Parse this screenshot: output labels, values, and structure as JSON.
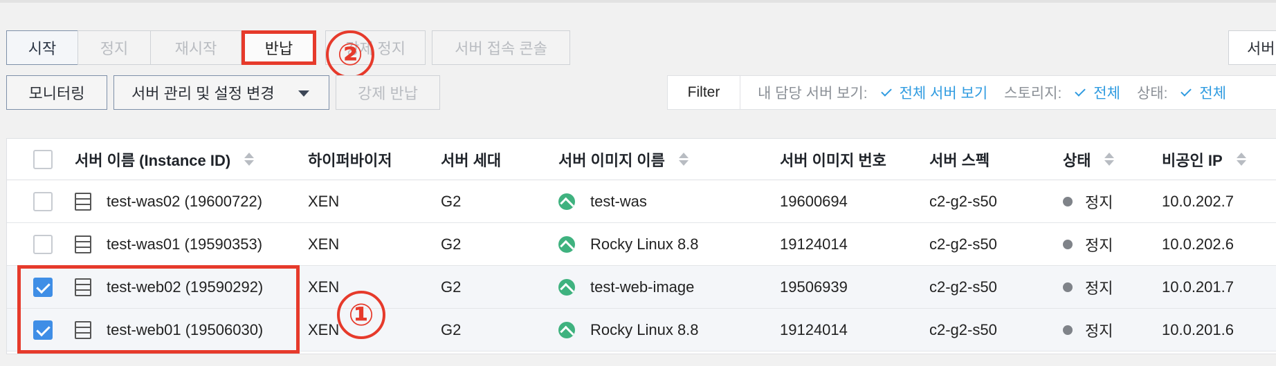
{
  "toolbar": {
    "row1": {
      "start": "시작",
      "stop": "정지",
      "restart": "재시작",
      "return": "반납",
      "force_stop": "강제 정지",
      "console": "서버 접속 콘솔",
      "right_cut": "서버"
    },
    "row2": {
      "monitoring": "모니터링",
      "manage": "서버 관리 및 설정 변경",
      "force_return": "강제 반납"
    }
  },
  "markers": {
    "one": "①",
    "two": "②"
  },
  "filter": {
    "label": "Filter",
    "my_servers_key": "내 담당 서버 보기:",
    "my_servers_value": "전체 서버 보기",
    "storage_key": "스토리지:",
    "storage_value": "전체",
    "status_key": "상태:",
    "status_value": "전체"
  },
  "table": {
    "headers": {
      "name": "서버 이름 (Instance ID)",
      "hypervisor": "하이퍼바이저",
      "generation": "서버 세대",
      "image_name": "서버 이미지 이름",
      "image_no": "서버 이미지 번호",
      "spec": "서버 스펙",
      "status": "상태",
      "private_ip": "비공인 IP"
    },
    "rows": [
      {
        "name": "test-was02 (19600722)",
        "hypervisor": "XEN",
        "generation": "G2",
        "image_name": "test-was",
        "image_no": "19600694",
        "spec": "c2-g2-s50",
        "status": "정지",
        "private_ip": "10.0.202.7",
        "checked": false
      },
      {
        "name": "test-was01 (19590353)",
        "hypervisor": "XEN",
        "generation": "G2",
        "image_name": "Rocky Linux 8.8",
        "image_no": "19124014",
        "spec": "c2-g2-s50",
        "status": "정지",
        "private_ip": "10.0.202.6",
        "checked": false
      },
      {
        "name": "test-web02 (19590292)",
        "hypervisor": "XEN",
        "generation": "G2",
        "image_name": "test-web-image",
        "image_no": "19506939",
        "spec": "c2-g2-s50",
        "status": "정지",
        "private_ip": "10.0.201.7",
        "checked": true
      },
      {
        "name": "test-web01 (19506030)",
        "hypervisor": "XEN",
        "generation": "G2",
        "image_name": "Rocky Linux 8.8",
        "image_no": "19124014",
        "spec": "c2-g2-s50",
        "status": "정지",
        "private_ip": "10.0.201.6",
        "checked": true
      }
    ]
  },
  "colors": {
    "highlight": "#e63a2b",
    "link": "#2f9be0",
    "checkbox_on": "#3f8ee6",
    "image_icon": "#3fb27f",
    "status_dot": "#7f8389"
  },
  "icons": {
    "server": "server-icon",
    "image": "image-icon",
    "sort": "sort-icon",
    "check": "check-icon",
    "dropdown": "chevron-down-icon"
  }
}
